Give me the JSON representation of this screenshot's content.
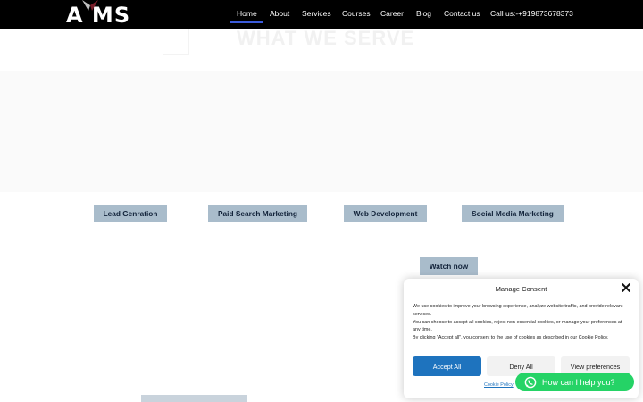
{
  "header": {
    "logo_text": "A MS",
    "nav": [
      {
        "label": "Home",
        "active": true
      },
      {
        "label": "About"
      },
      {
        "label": "Services"
      },
      {
        "label": "Courses"
      },
      {
        "label": "Career"
      },
      {
        "label": "Blog"
      },
      {
        "label": "Contact us"
      },
      {
        "label": "Call us:-+919873678373"
      }
    ]
  },
  "hero": {
    "title": "WHAT WE SERVE"
  },
  "services": [
    {
      "label": "Lead Genration"
    },
    {
      "label": "Paid Search Marketing"
    },
    {
      "label": "Web Development"
    },
    {
      "label": "Social Media Marketing"
    }
  ],
  "watch_button": "Watch now",
  "consent": {
    "title": "Manage Consent",
    "paragraphs": [
      "We use cookies to improve your browsing experience, analyze website traffic, and provide relevant services.",
      "You can choose to accept all cookies, reject non-essential cookies, or manage your preferences at any time.",
      "By clicking \"Accept all\", you consent to the use of cookies as described in our Cookie Policy."
    ],
    "accept_label": "Accept All",
    "deny_label": "Deny All",
    "view_label": "View preferences",
    "policy_link": "Cookie Policy"
  },
  "whatsapp": {
    "label": "How can I help you?"
  },
  "colors": {
    "nav_bg": "#000000",
    "button_bg": "#a9bccb",
    "accept": "#1e73be",
    "whatsapp": "#25d366"
  }
}
